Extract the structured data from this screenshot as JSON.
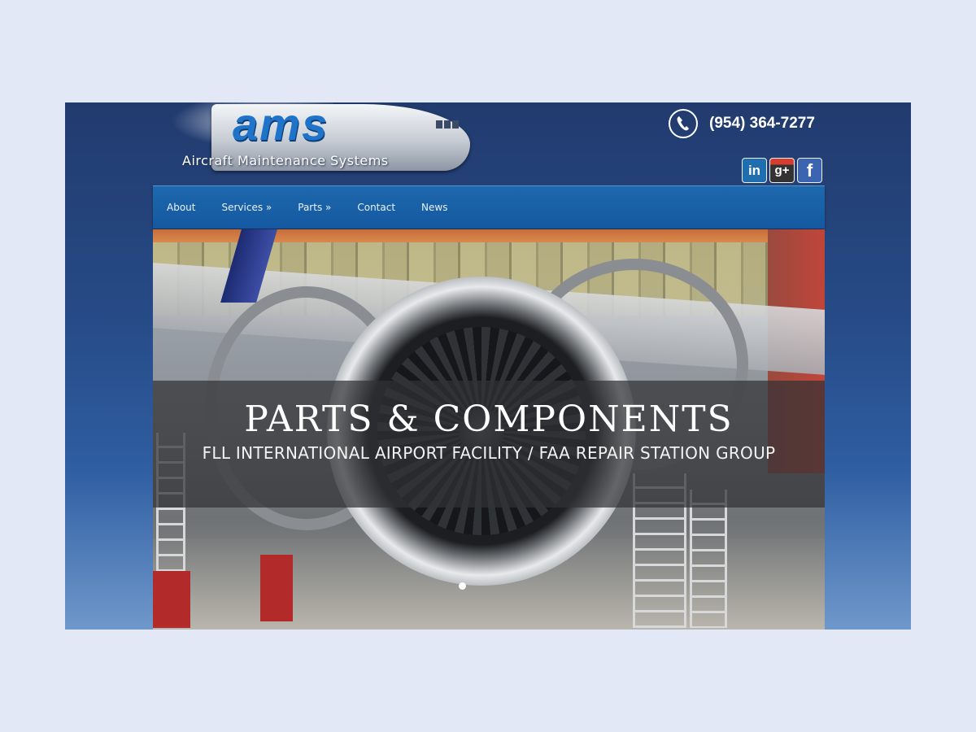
{
  "brand": {
    "logo_text": "ams",
    "tagline": "Aircraft Maintenance Systems"
  },
  "header": {
    "phone": "(954) 364-7277",
    "social": [
      {
        "name": "linkedin-icon",
        "glyph": "in"
      },
      {
        "name": "googleplus-icon",
        "glyph": "g+"
      },
      {
        "name": "facebook-icon",
        "glyph": "f"
      }
    ]
  },
  "nav": {
    "items": [
      "About",
      "Services »",
      "Parts »",
      "Contact",
      "News"
    ]
  },
  "hero": {
    "title": "PARTS & COMPONENTS",
    "subtitle": "FLL INTERNATIONAL AIRPORT FACILITY / FAA REPAIR STATION GROUP",
    "slides": 2,
    "active_slide": 1
  },
  "colors": {
    "page_bg": "#e3e8f6",
    "site_bg": "#264a86",
    "nav_bg": "#1459a1",
    "logo_blue": "#1f73c8"
  }
}
